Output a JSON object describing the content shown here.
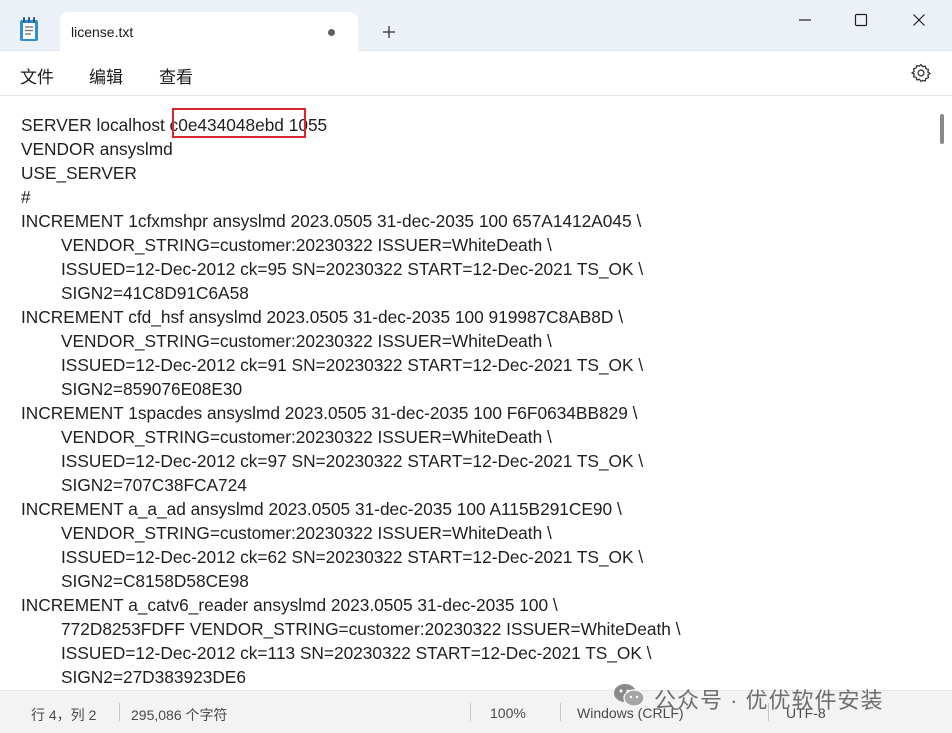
{
  "window": {
    "tab_title": "license.txt",
    "new_tab_symbol": "+",
    "icons": [
      "notepad-icon",
      "unsaved-dot-icon",
      "plus-icon",
      "minimize-icon",
      "maximize-icon",
      "close-icon"
    ]
  },
  "menu": {
    "items": [
      "文件",
      "编辑",
      "查看"
    ],
    "settings_icon": "gear-icon"
  },
  "editor": {
    "highlight_color": "#d9262f",
    "lines": [
      "SERVER localhost c0e434048ebd 1055",
      "VENDOR ansyslmd",
      "USE_SERVER",
      "#",
      "INCREMENT 1cfxmshpr ansyslmd 2023.0505 31-dec-2035 100 657A1412A045 \\",
      "VENDOR_STRING=customer:20230322 ISSUER=WhiteDeath \\",
      "ISSUED=12-Dec-2012 ck=95 SN=20230322 START=12-Dec-2021 TS_OK \\",
      "SIGN2=41C8D91C6A58",
      "INCREMENT cfd_hsf ansyslmd 2023.0505 31-dec-2035 100 919987C8AB8D \\",
      "VENDOR_STRING=customer:20230322 ISSUER=WhiteDeath \\",
      "ISSUED=12-Dec-2012 ck=91 SN=20230322 START=12-Dec-2021 TS_OK \\",
      "SIGN2=859076E08E30",
      "INCREMENT 1spacdes ansyslmd 2023.0505 31-dec-2035 100 F6F0634BB829 \\",
      "VENDOR_STRING=customer:20230322 ISSUER=WhiteDeath \\",
      "ISSUED=12-Dec-2012 ck=97 SN=20230322 START=12-Dec-2021 TS_OK \\",
      "SIGN2=707C38FCA724",
      "INCREMENT a_a_ad ansyslmd 2023.0505 31-dec-2035 100 A115B291CE90 \\",
      "VENDOR_STRING=customer:20230322 ISSUER=WhiteDeath \\",
      "ISSUED=12-Dec-2012 ck=62 SN=20230322 START=12-Dec-2021 TS_OK \\",
      "SIGN2=C8158D58CE98",
      "INCREMENT a_catv6_reader ansyslmd 2023.0505 31-dec-2035 100 \\",
      "772D8253FDFF VENDOR_STRING=customer:20230322 ISSUER=WhiteDeath \\",
      "ISSUED=12-Dec-2012 ck=113 SN=20230322 START=12-Dec-2021 TS_OK \\",
      "SIGN2=27D383923DE6"
    ]
  },
  "status": {
    "position": "行 4，列 2",
    "char_count": "295,086 个字符",
    "zoom": "100%",
    "line_ending": "Windows (CRLF)",
    "encoding": "UTF-8"
  },
  "watermark": {
    "text": "公众号 · 优优软件安装",
    "icon": "wechat-icon"
  }
}
